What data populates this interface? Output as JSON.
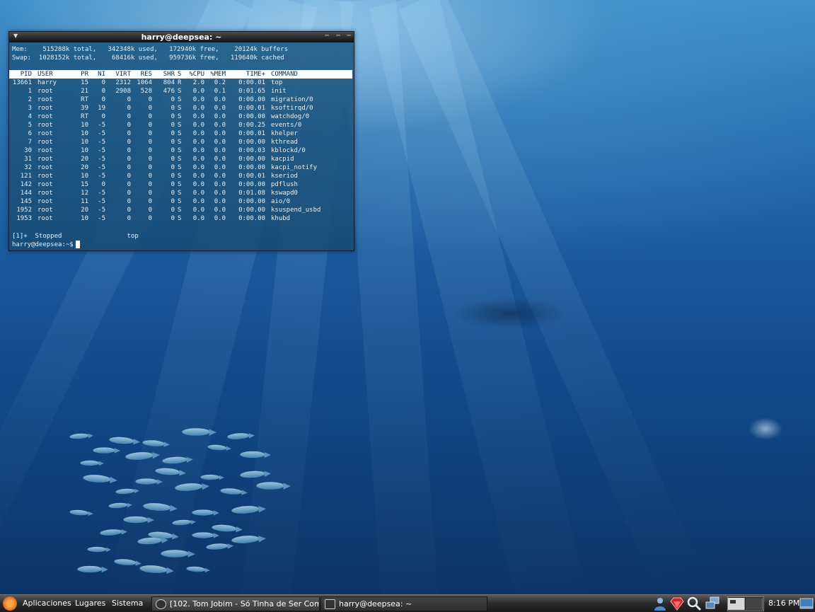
{
  "terminal": {
    "title": "harry@deepsea: ~",
    "mem_line": "Mem:    515288k total,   342348k used,   172940k free,    20124k buffers",
    "swap_line": "Swap:  1028152k total,    68416k used,   959736k free,   119640k cached",
    "columns": [
      "PID",
      "USER",
      "PR",
      "NI",
      "VIRT",
      "RES",
      "SHR",
      "S",
      "%CPU",
      "%MEM",
      "TIME+",
      "COMMAND"
    ],
    "rows": [
      [
        "13661",
        "harry",
        "15",
        "0",
        "2312",
        "1064",
        "804",
        "R",
        "2.0",
        "0.2",
        "0:00.01",
        "top"
      ],
      [
        "1",
        "root",
        "21",
        "0",
        "2908",
        "528",
        "476",
        "S",
        "0.0",
        "0.1",
        "0:01.65",
        "init"
      ],
      [
        "2",
        "root",
        "RT",
        "0",
        "0",
        "0",
        "0",
        "S",
        "0.0",
        "0.0",
        "0:00.00",
        "migration/0"
      ],
      [
        "3",
        "root",
        "39",
        "19",
        "0",
        "0",
        "0",
        "S",
        "0.0",
        "0.0",
        "0:00.01",
        "ksoftirqd/0"
      ],
      [
        "4",
        "root",
        "RT",
        "0",
        "0",
        "0",
        "0",
        "S",
        "0.0",
        "0.0",
        "0:00.00",
        "watchdog/0"
      ],
      [
        "5",
        "root",
        "10",
        "-5",
        "0",
        "0",
        "0",
        "S",
        "0.0",
        "0.0",
        "0:00.25",
        "events/0"
      ],
      [
        "6",
        "root",
        "10",
        "-5",
        "0",
        "0",
        "0",
        "S",
        "0.0",
        "0.0",
        "0:00.01",
        "khelper"
      ],
      [
        "7",
        "root",
        "10",
        "-5",
        "0",
        "0",
        "0",
        "S",
        "0.0",
        "0.0",
        "0:00.00",
        "kthread"
      ],
      [
        "30",
        "root",
        "10",
        "-5",
        "0",
        "0",
        "0",
        "S",
        "0.0",
        "0.0",
        "0:00.03",
        "kblockd/0"
      ],
      [
        "31",
        "root",
        "20",
        "-5",
        "0",
        "0",
        "0",
        "S",
        "0.0",
        "0.0",
        "0:00.00",
        "kacpid"
      ],
      [
        "32",
        "root",
        "20",
        "-5",
        "0",
        "0",
        "0",
        "S",
        "0.0",
        "0.0",
        "0:00.00",
        "kacpi_notify"
      ],
      [
        "121",
        "root",
        "10",
        "-5",
        "0",
        "0",
        "0",
        "S",
        "0.0",
        "0.0",
        "0:00.01",
        "kseriod"
      ],
      [
        "142",
        "root",
        "15",
        "0",
        "0",
        "0",
        "0",
        "S",
        "0.0",
        "0.0",
        "0:00.00",
        "pdflush"
      ],
      [
        "144",
        "root",
        "12",
        "-5",
        "0",
        "0",
        "0",
        "S",
        "0.0",
        "0.0",
        "0:01.08",
        "kswapd0"
      ],
      [
        "145",
        "root",
        "11",
        "-5",
        "0",
        "0",
        "0",
        "S",
        "0.0",
        "0.0",
        "0:00.00",
        "aio/0"
      ],
      [
        "1952",
        "root",
        "20",
        "-5",
        "0",
        "0",
        "0",
        "S",
        "0.0",
        "0.0",
        "0:00.00",
        "ksuspend_usbd"
      ],
      [
        "1953",
        "root",
        "10",
        "-5",
        "0",
        "0",
        "0",
        "S",
        "0.0",
        "0.0",
        "0:00.00",
        "khubd"
      ]
    ],
    "job_line": "[1]+  Stopped                 top",
    "prompt": "harry@deepsea:~$"
  },
  "panel": {
    "menus": [
      "Aplicaciones",
      "Lugares",
      "Sistema"
    ],
    "tasks": [
      "[102. Tom Jobim - Só Tinha de Ser Com ...",
      "harry@deepsea: ~"
    ],
    "clock": "8:16 PM"
  },
  "icons": {
    "window_menu": "window-menu-icon",
    "minimize": "minimize-icon",
    "maximize": "maximize-icon",
    "close": "close-icon",
    "distro_logo": "ubuntu-logo-icon",
    "media_player": "media-player-icon",
    "terminal": "terminal-icon",
    "user": "user-icon",
    "ruby": "ruby-gem-icon",
    "search": "search-icon",
    "network": "network-icon",
    "workspace_switcher": "workspace-switcher",
    "show_desktop": "show-desktop-icon"
  },
  "colors": {
    "terminal_bg": "#1e5a82",
    "terminal_fg": "#e7eef4",
    "header_bar": "#ffffff",
    "panel_bg": "#2a2a2a"
  }
}
